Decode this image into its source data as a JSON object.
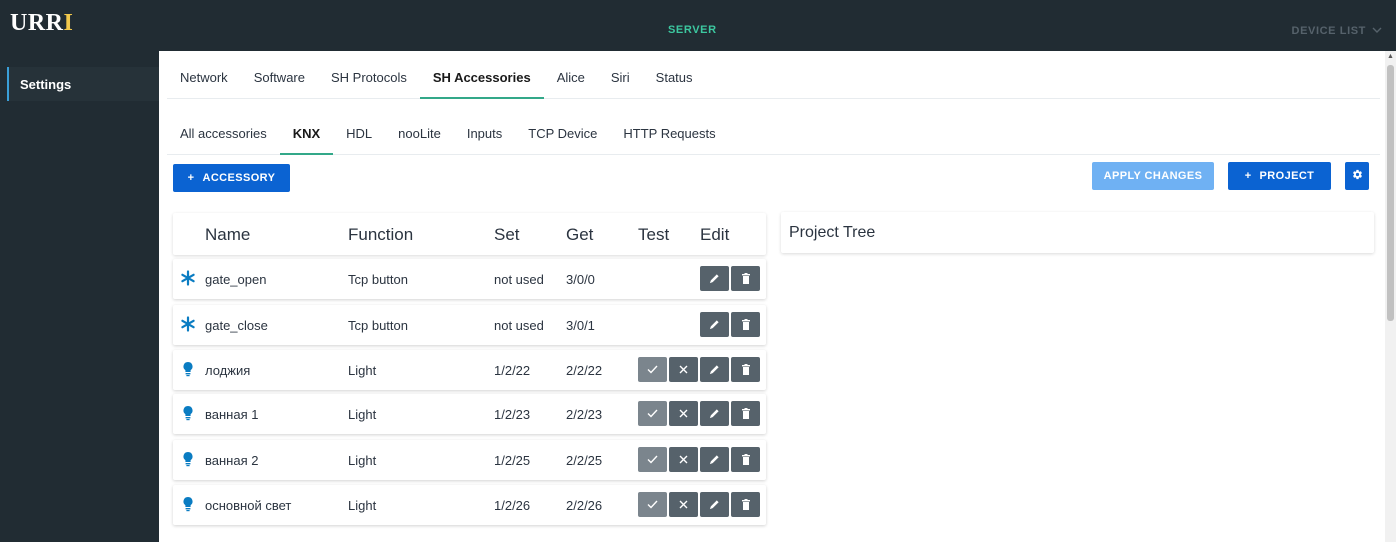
{
  "app": {
    "logo_main": "URR",
    "logo_accent": "I",
    "server_label": "SERVER",
    "device_list_label": "DEVICE LIST"
  },
  "sidebar": {
    "items": [
      {
        "label": "Settings"
      }
    ]
  },
  "main_tabs": [
    "Network",
    "Software",
    "SH Protocols",
    "SH Accessories",
    "Alice",
    "Siri",
    "Status"
  ],
  "main_tab_active": "SH Accessories",
  "sub_tabs": [
    "All accessories",
    "KNX",
    "HDL",
    "nooLite",
    "Inputs",
    "TCP Device",
    "HTTP Requests"
  ],
  "sub_tab_active": "KNX",
  "toolbar": {
    "add_accessory": "ACCESSORY",
    "apply_changes": "APPLY CHANGES",
    "add_project": "PROJECT"
  },
  "table": {
    "headers": {
      "name": "Name",
      "function": "Function",
      "set": "Set",
      "get": "Get",
      "test": "Test",
      "edit": "Edit"
    },
    "rows": [
      {
        "icon": "asterisk-icon",
        "name": "gate_open",
        "function": "Tcp button",
        "set": "not used",
        "get": "3/0/0",
        "test": false
      },
      {
        "icon": "asterisk-icon",
        "name": "gate_close",
        "function": "Tcp button",
        "set": "not used",
        "get": "3/0/1",
        "test": false
      },
      {
        "icon": "lightbulb-icon",
        "name": "лоджия",
        "function": "Light",
        "set": "1/2/22",
        "get": "2/2/22",
        "test": true
      },
      {
        "icon": "lightbulb-icon",
        "name": "ванная 1",
        "function": "Light",
        "set": "1/2/23",
        "get": "2/2/23",
        "test": true
      },
      {
        "icon": "lightbulb-icon",
        "name": "ванная 2",
        "function": "Light",
        "set": "1/2/25",
        "get": "2/2/25",
        "test": true
      },
      {
        "icon": "lightbulb-icon",
        "name": "основной свет",
        "function": "Light",
        "set": "1/2/26",
        "get": "2/2/26",
        "test": true
      }
    ]
  },
  "project_tree": {
    "title": "Project Tree"
  },
  "colors": {
    "topbar": "#212c33",
    "primary_button": "#0b63d2",
    "apply_button": "#6fb1f3",
    "tab_underline": "#33a889",
    "server_label": "#3cc8a0",
    "row_icon": "#0a7cc2"
  }
}
